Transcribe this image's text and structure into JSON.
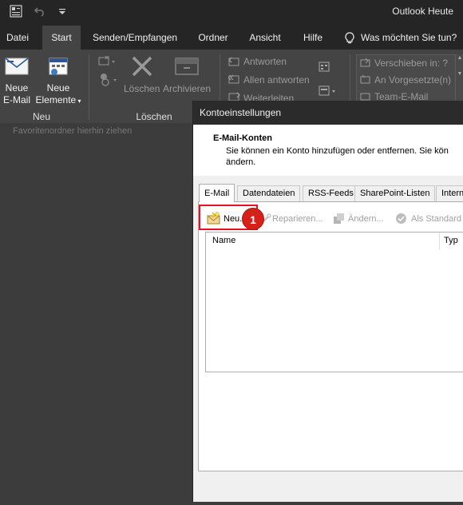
{
  "app": {
    "title": "Outlook Heute"
  },
  "quick_access": [
    "app-icon",
    "undo-icon",
    "customize-icon"
  ],
  "menu": {
    "tabs": [
      {
        "label": "Datei"
      },
      {
        "label": "Start"
      },
      {
        "label": "Senden/Empfangen"
      },
      {
        "label": "Ordner"
      },
      {
        "label": "Ansicht"
      },
      {
        "label": "Hilfe"
      }
    ],
    "tell_me": "Was möchten Sie tun?"
  },
  "ribbon": {
    "new_mail": {
      "line1": "Neue",
      "line2": "E-Mail"
    },
    "new_items": {
      "line1": "Neue",
      "line2": "Elemente"
    },
    "group_new": "Neu",
    "delete": "Löschen",
    "archive": "Archivieren",
    "group_delete": "Löschen",
    "reply": "Antworten",
    "reply_all": "Allen antworten",
    "forward": "Weiterleiten",
    "quick_steps": [
      "Verschieben in: ?",
      "An Vorgesetzte(n)",
      "Team-E-Mail"
    ]
  },
  "nav": {
    "favorites_hint": "Favoritenordner hierhin ziehen"
  },
  "dialog": {
    "title": "Kontoeinstellungen",
    "header_title": "E-Mail-Konten",
    "header_desc_line1": "Sie können ein Konto hinzufügen oder entfernen. Sie kön",
    "header_desc_line2": "ändern.",
    "tabs": [
      "E-Mail",
      "Datendateien",
      "RSS-Feeds",
      "SharePoint-Listen",
      "Intern"
    ],
    "toolbar": {
      "new": "Neu...",
      "repair": "Reparieren...",
      "change": "Ändern...",
      "default": "Als Standard"
    },
    "columns": [
      "Name",
      "Typ"
    ]
  },
  "annotation": {
    "step": "1",
    "color": "#e81123"
  }
}
